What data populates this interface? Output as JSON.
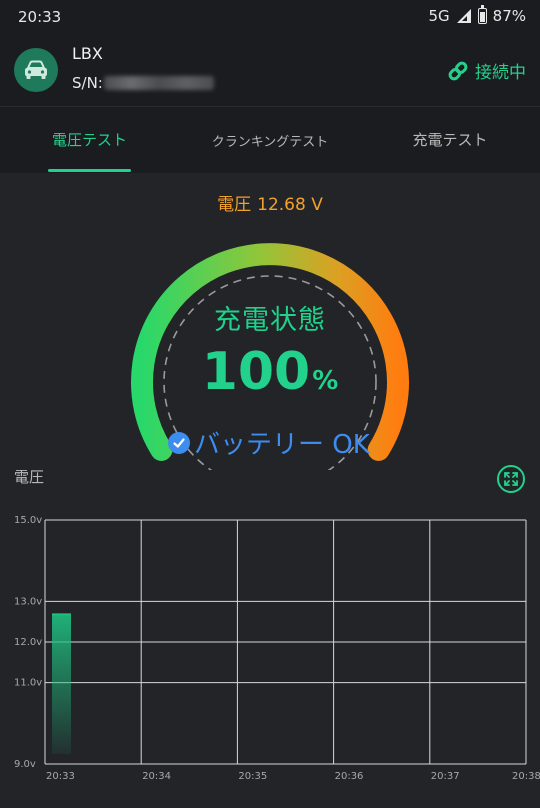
{
  "status": {
    "time": "20:33",
    "network": "5G",
    "battery": "87%"
  },
  "header": {
    "device_name": "LBX",
    "serial_label": "S/N:",
    "connection_status": "接続中",
    "avatar_icon": "car-icon",
    "connection_icon": "link-icon"
  },
  "tabs": [
    {
      "label": "電圧テスト",
      "active": true
    },
    {
      "label": "クランキングテスト",
      "active": false
    },
    {
      "label": "充電テスト",
      "active": false
    }
  ],
  "readout": {
    "label": "電圧",
    "value": "12.68 V"
  },
  "gauge": {
    "title": "充電状態",
    "value": "100",
    "unit": "%",
    "percent": 100,
    "status": "バッテリー OK"
  },
  "chart_section": {
    "title": "電圧",
    "expand_icon": "expand-icon"
  },
  "chart_data": {
    "type": "bar",
    "title": "",
    "xlabel": "",
    "ylabel": "",
    "ylim": [
      9.0,
      15.0
    ],
    "y_ticks": [
      "15.0v",
      "13.0v",
      "12.0v",
      "11.0v",
      "9.0v"
    ],
    "y_tick_values": [
      15.0,
      13.0,
      12.0,
      11.0,
      9.0
    ],
    "x_ticks": [
      "20:33",
      "20:34",
      "20:35",
      "20:36",
      "20:37",
      "20:38"
    ],
    "grid": true,
    "series": [
      {
        "x": [
          "20:33"
        ],
        "values": [
          12.68
        ]
      }
    ],
    "colors": {
      "bar": "#1fbf80",
      "grid": "#d8d8d8"
    }
  },
  "colors": {
    "accent": "#21d18c",
    "warning": "#f2a12a",
    "ok": "#3d8cf0"
  }
}
